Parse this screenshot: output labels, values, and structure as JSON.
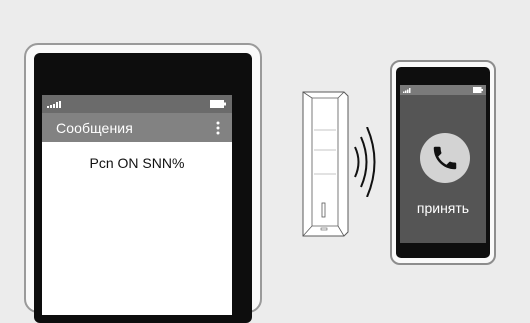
{
  "left_phone": {
    "app_title": "Сообщения",
    "message": "Pcn ON SNN%",
    "icons": {
      "signal": "signal-icon",
      "battery": "battery-icon",
      "menu": "more-vert-icon"
    }
  },
  "right_phone": {
    "accept_label": "принять",
    "icons": {
      "signal": "signal-icon",
      "battery": "battery-icon",
      "call": "phone-icon"
    }
  },
  "device": {
    "icons": {
      "device": "gsm-device-icon",
      "waves": "signal-waves-icon"
    }
  },
  "colors": {
    "background": "#ececec",
    "appbar": "#828282",
    "statusbar": "#6b6b6b",
    "right_screen": "#555555",
    "call_circle": "#d3d3d3"
  }
}
